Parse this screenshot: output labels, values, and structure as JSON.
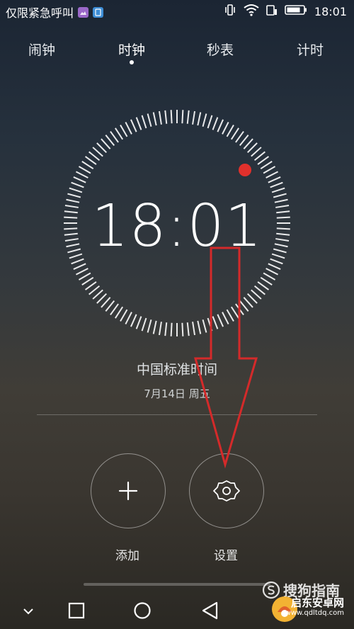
{
  "status_bar": {
    "carrier": "仅限紧急呼叫",
    "time": "18:01",
    "colors": {
      "app1": "#9a68c9",
      "app2": "#3e8ed6"
    },
    "icons": [
      "gallery-app-icon",
      "sim-app-icon",
      "vibrate-icon",
      "wifi-icon",
      "sim-signal-icon",
      "battery-icon"
    ]
  },
  "tabs": [
    {
      "label": "闹钟",
      "selected": false
    },
    {
      "label": "时钟",
      "selected": true
    },
    {
      "label": "秒表",
      "selected": false
    },
    {
      "label": "计时",
      "selected": false
    }
  ],
  "clock": {
    "time": "18:01",
    "timezone": "中国标准时间",
    "date": "7月14日 周五",
    "second_dot_color": "#e0302c"
  },
  "actions": {
    "add_label": "添加",
    "settings_label": "设置"
  },
  "annotation": {
    "arrow_color": "#d42a2a"
  },
  "nav": {
    "icons": [
      "chevron-down-icon",
      "square-icon",
      "circle-icon",
      "triangle-back-icon"
    ]
  },
  "watermarks": {
    "sogou": "搜狗指南",
    "site_name": "启东安卓网",
    "site_url": "www.qdltdq.com"
  }
}
